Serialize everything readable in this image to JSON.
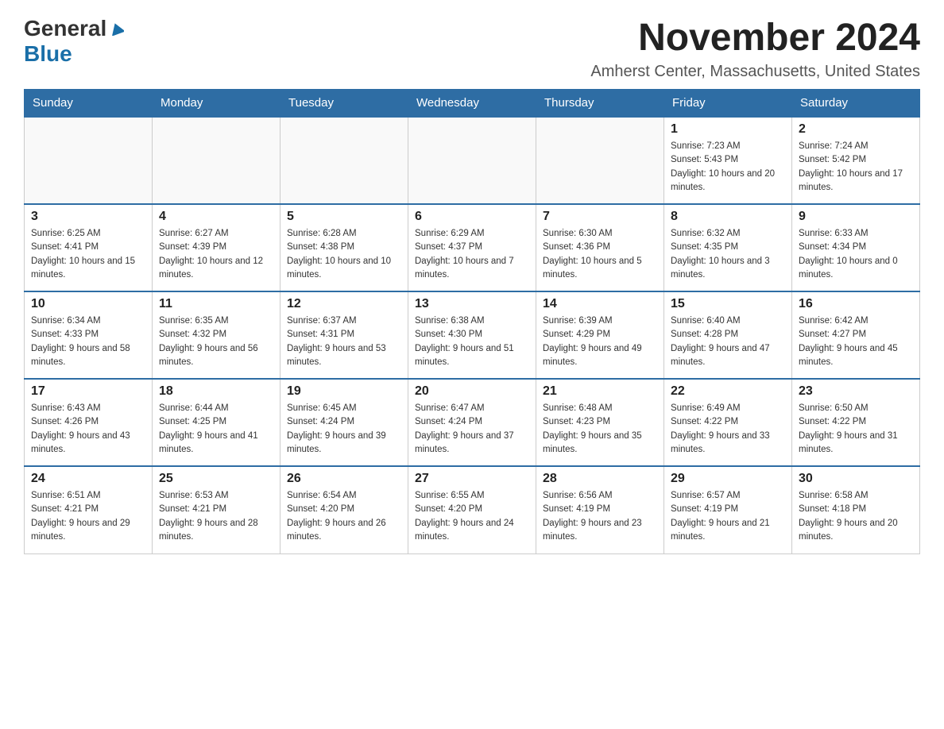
{
  "header": {
    "logo_general": "General",
    "logo_blue": "Blue",
    "month": "November 2024",
    "location": "Amherst Center, Massachusetts, United States"
  },
  "weekdays": [
    "Sunday",
    "Monday",
    "Tuesday",
    "Wednesday",
    "Thursday",
    "Friday",
    "Saturday"
  ],
  "weeks": [
    [
      {
        "day": "",
        "info": ""
      },
      {
        "day": "",
        "info": ""
      },
      {
        "day": "",
        "info": ""
      },
      {
        "day": "",
        "info": ""
      },
      {
        "day": "",
        "info": ""
      },
      {
        "day": "1",
        "info": "Sunrise: 7:23 AM\nSunset: 5:43 PM\nDaylight: 10 hours and 20 minutes."
      },
      {
        "day": "2",
        "info": "Sunrise: 7:24 AM\nSunset: 5:42 PM\nDaylight: 10 hours and 17 minutes."
      }
    ],
    [
      {
        "day": "3",
        "info": "Sunrise: 6:25 AM\nSunset: 4:41 PM\nDaylight: 10 hours and 15 minutes."
      },
      {
        "day": "4",
        "info": "Sunrise: 6:27 AM\nSunset: 4:39 PM\nDaylight: 10 hours and 12 minutes."
      },
      {
        "day": "5",
        "info": "Sunrise: 6:28 AM\nSunset: 4:38 PM\nDaylight: 10 hours and 10 minutes."
      },
      {
        "day": "6",
        "info": "Sunrise: 6:29 AM\nSunset: 4:37 PM\nDaylight: 10 hours and 7 minutes."
      },
      {
        "day": "7",
        "info": "Sunrise: 6:30 AM\nSunset: 4:36 PM\nDaylight: 10 hours and 5 minutes."
      },
      {
        "day": "8",
        "info": "Sunrise: 6:32 AM\nSunset: 4:35 PM\nDaylight: 10 hours and 3 minutes."
      },
      {
        "day": "9",
        "info": "Sunrise: 6:33 AM\nSunset: 4:34 PM\nDaylight: 10 hours and 0 minutes."
      }
    ],
    [
      {
        "day": "10",
        "info": "Sunrise: 6:34 AM\nSunset: 4:33 PM\nDaylight: 9 hours and 58 minutes."
      },
      {
        "day": "11",
        "info": "Sunrise: 6:35 AM\nSunset: 4:32 PM\nDaylight: 9 hours and 56 minutes."
      },
      {
        "day": "12",
        "info": "Sunrise: 6:37 AM\nSunset: 4:31 PM\nDaylight: 9 hours and 53 minutes."
      },
      {
        "day": "13",
        "info": "Sunrise: 6:38 AM\nSunset: 4:30 PM\nDaylight: 9 hours and 51 minutes."
      },
      {
        "day": "14",
        "info": "Sunrise: 6:39 AM\nSunset: 4:29 PM\nDaylight: 9 hours and 49 minutes."
      },
      {
        "day": "15",
        "info": "Sunrise: 6:40 AM\nSunset: 4:28 PM\nDaylight: 9 hours and 47 minutes."
      },
      {
        "day": "16",
        "info": "Sunrise: 6:42 AM\nSunset: 4:27 PM\nDaylight: 9 hours and 45 minutes."
      }
    ],
    [
      {
        "day": "17",
        "info": "Sunrise: 6:43 AM\nSunset: 4:26 PM\nDaylight: 9 hours and 43 minutes."
      },
      {
        "day": "18",
        "info": "Sunrise: 6:44 AM\nSunset: 4:25 PM\nDaylight: 9 hours and 41 minutes."
      },
      {
        "day": "19",
        "info": "Sunrise: 6:45 AM\nSunset: 4:24 PM\nDaylight: 9 hours and 39 minutes."
      },
      {
        "day": "20",
        "info": "Sunrise: 6:47 AM\nSunset: 4:24 PM\nDaylight: 9 hours and 37 minutes."
      },
      {
        "day": "21",
        "info": "Sunrise: 6:48 AM\nSunset: 4:23 PM\nDaylight: 9 hours and 35 minutes."
      },
      {
        "day": "22",
        "info": "Sunrise: 6:49 AM\nSunset: 4:22 PM\nDaylight: 9 hours and 33 minutes."
      },
      {
        "day": "23",
        "info": "Sunrise: 6:50 AM\nSunset: 4:22 PM\nDaylight: 9 hours and 31 minutes."
      }
    ],
    [
      {
        "day": "24",
        "info": "Sunrise: 6:51 AM\nSunset: 4:21 PM\nDaylight: 9 hours and 29 minutes."
      },
      {
        "day": "25",
        "info": "Sunrise: 6:53 AM\nSunset: 4:21 PM\nDaylight: 9 hours and 28 minutes."
      },
      {
        "day": "26",
        "info": "Sunrise: 6:54 AM\nSunset: 4:20 PM\nDaylight: 9 hours and 26 minutes."
      },
      {
        "day": "27",
        "info": "Sunrise: 6:55 AM\nSunset: 4:20 PM\nDaylight: 9 hours and 24 minutes."
      },
      {
        "day": "28",
        "info": "Sunrise: 6:56 AM\nSunset: 4:19 PM\nDaylight: 9 hours and 23 minutes."
      },
      {
        "day": "29",
        "info": "Sunrise: 6:57 AM\nSunset: 4:19 PM\nDaylight: 9 hours and 21 minutes."
      },
      {
        "day": "30",
        "info": "Sunrise: 6:58 AM\nSunset: 4:18 PM\nDaylight: 9 hours and 20 minutes."
      }
    ]
  ]
}
